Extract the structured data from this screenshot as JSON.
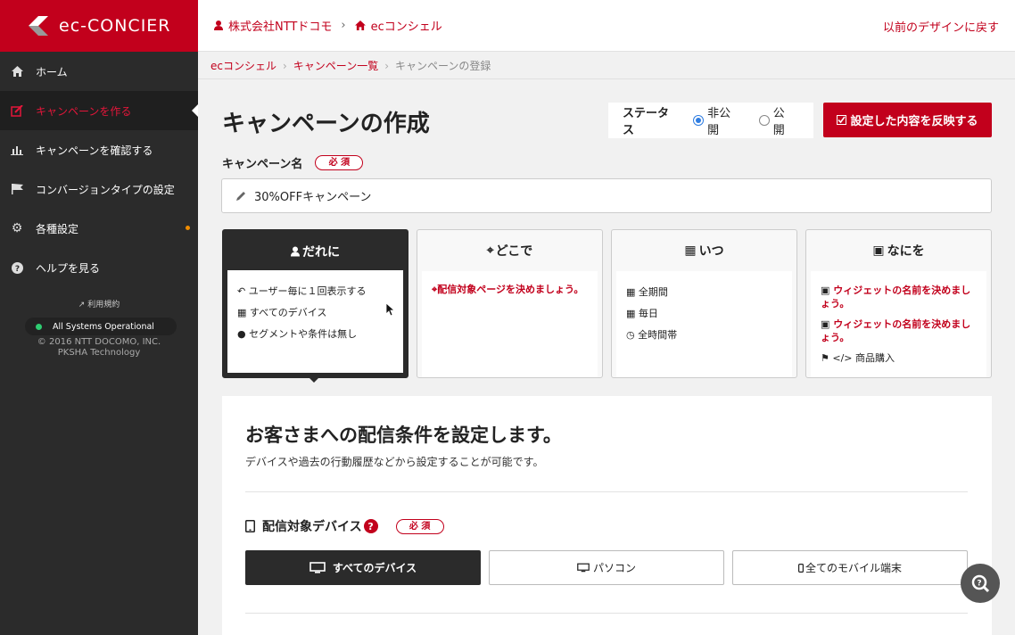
{
  "logo": {
    "text": "ec-CONCIER"
  },
  "sidebar": {
    "items": [
      {
        "label": "ホーム"
      },
      {
        "label": "キャンペーンを作る"
      },
      {
        "label": "キャンペーンを確認する"
      },
      {
        "label": "コンバージョンタイプの設定"
      },
      {
        "label": "各種設定"
      },
      {
        "label": "ヘルプを見る"
      }
    ],
    "terms": "利用規約",
    "system_status": "All Systems Operational",
    "copyright_1": "© 2016 NTT DOCOMO, INC.",
    "copyright_2": "PKSHA Technology"
  },
  "topbar": {
    "company": "株式会社NTTドコモ",
    "service": "ecコンシェル",
    "back_link": "以前のデザインに戻す"
  },
  "breadcrumb": {
    "root": "ecコンシェル",
    "list": "キャンペーン一覧",
    "current": "キャンペーンの登録"
  },
  "page": {
    "title": "キャンペーンの作成"
  },
  "status": {
    "label": "ステータス",
    "private": "非公開",
    "public": "公開",
    "selected": "非公開"
  },
  "apply_button": "設定した内容を反映する",
  "campaign_name": {
    "label": "キャンペーン名",
    "required": "必 須",
    "value": "30%OFFキャンペーン"
  },
  "cards": {
    "who": {
      "title": "だれに",
      "lines": [
        "ユーザー毎に１回表示する",
        "すべてのデバイス",
        "セグメントや条件は無し"
      ]
    },
    "where": {
      "title": "どこで",
      "lines": [
        "配信対象ページを決めましょう。"
      ]
    },
    "when": {
      "title": "いつ",
      "lines": [
        "全期間",
        "毎日",
        "全時間帯"
      ]
    },
    "what": {
      "title": "なにを",
      "lines": [
        "ウィジェットの名前を決めましょう。",
        "ウィジェットの名前を決めましょう。",
        "商品購入"
      ]
    }
  },
  "panel": {
    "heading": "お客さまへの配信条件を設定します。",
    "description": "デバイスや過去の行動履歴などから設定することが可能です。",
    "device_label": "配信対象デバイス",
    "required": "必 須",
    "device_options": [
      "すべてのデバイス",
      "パソコン",
      "全てのモバイル端末"
    ],
    "selected_device": "すべてのデバイス"
  },
  "colors": {
    "brand": "#c2001c",
    "sidebar": "#2b2b2b",
    "radio": "#2f7de1"
  }
}
